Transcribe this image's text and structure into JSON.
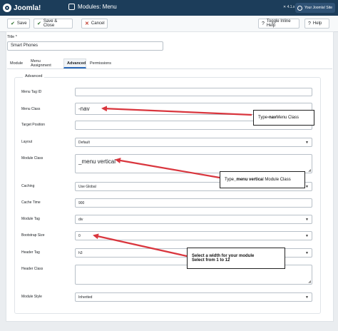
{
  "header": {
    "logo": "Joomla!",
    "title": "Modules: Menu",
    "version": "✕ 4.1.x",
    "user_menu": "Your Joomla! Site"
  },
  "toolbar": {
    "save": "Save",
    "save_close": "Save & Close",
    "cancel": "Cancel",
    "toggle_help": "Toggle Inline Help",
    "help": "Help"
  },
  "form": {
    "title_label": "Title *",
    "title_value": "Smart Phones",
    "tabs": [
      "Module",
      "Menu Assignment",
      "Advanced",
      "Permissions"
    ],
    "active_tab": "Advanced",
    "legend": "Advanced",
    "fields": {
      "menu_tag_id": {
        "label": "Menu Tag ID",
        "value": ""
      },
      "menu_class": {
        "label": "Menu Class",
        "value": "-nav"
      },
      "target_position": {
        "label": "Target Position",
        "value": ""
      },
      "layout": {
        "label": "Layout",
        "value": "Default"
      },
      "module_class": {
        "label": "Module Class",
        "value": "_menu vertical"
      },
      "caching": {
        "label": "Caching",
        "value": "Use Global"
      },
      "cache_time": {
        "label": "Cache Time",
        "value": "900"
      },
      "module_tag": {
        "label": "Module Tag",
        "value": "div"
      },
      "bootstrap_size": {
        "label": "Bootstrap Size",
        "value": "0"
      },
      "header_tag": {
        "label": "Header Tag",
        "value": "h3"
      },
      "header_class": {
        "label": "Header Class",
        "value": ""
      },
      "module_style": {
        "label": "Module Style",
        "value": "Inherited"
      }
    }
  },
  "annotations": {
    "nav": {
      "pre": "Type ",
      "bold": "-nav",
      "post": " Menu Class"
    },
    "vertical": {
      "pre": "Type ",
      "bold": "_menu vertica",
      "post": "l Module Class"
    },
    "bootstrap": {
      "line1": "Select a width for your module",
      "line2": "Select from 1 to 12"
    },
    "arrow_color": "#d9363e"
  }
}
